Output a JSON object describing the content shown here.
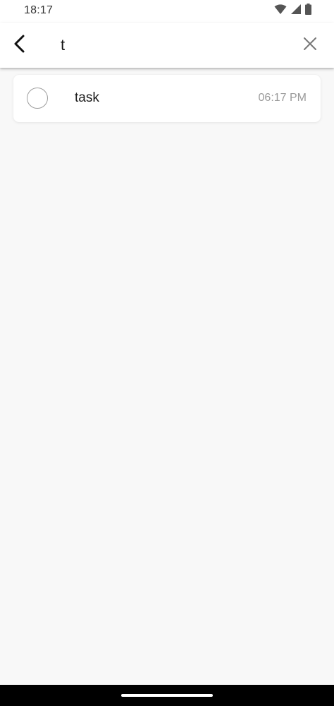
{
  "status_bar": {
    "time": "18:17",
    "icons": [
      "wifi-icon",
      "cellular-signal-icon",
      "battery-icon"
    ]
  },
  "app_bar": {
    "back_icon": "chevron-left-icon",
    "search_value": "t",
    "clear_icon": "close-icon"
  },
  "results": [
    {
      "title": "task",
      "time": "06:17 PM",
      "checked": false
    }
  ],
  "colors": {
    "background": "#f8f8f8",
    "surface": "#ffffff",
    "text_primary": "#1a1a1a",
    "text_secondary": "#9a9a9a",
    "checkbox_border": "#9e9e9e",
    "nav_bar": "#000000"
  }
}
